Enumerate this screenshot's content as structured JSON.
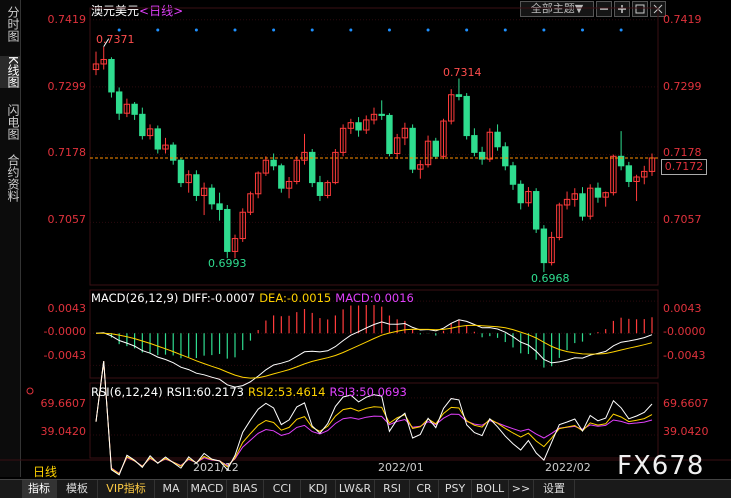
{
  "sidebar": {
    "tabs": [
      {
        "label": "分时图"
      },
      {
        "label": "K线图"
      },
      {
        "label": "闪电图"
      },
      {
        "label": "合约资料"
      }
    ]
  },
  "header": {
    "symbol": "澳元美元",
    "period": "<日线>",
    "theme_button": "全部主题",
    "theme_arrow": "▼"
  },
  "colors": {
    "up": "#ff3b3b",
    "down": "#2fdc8f",
    "macd_line": "#ffffff",
    "dea_line": "#ffd200",
    "macd_pos": "#ff3b3b",
    "macd_neg": "#2fdc8f",
    "rsi1": "#ffffff",
    "rsi2": "#ffd200",
    "rsi3": "#e040fb",
    "axis_text": "#e0323c",
    "current_price_line": "#ff8c00",
    "signal_dot": "#1e90ff"
  },
  "chart_data": [
    {
      "type": "candlestick",
      "ylim": [
        0.6945,
        0.744
      ],
      "y_ticks": [
        "0.7419",
        "0.7299",
        "0.7178",
        "0.7057"
      ],
      "current_price": "0.7172",
      "annotations": {
        "high1": "0.7371",
        "high2": "0.7314",
        "low1": "0.6993",
        "low2": "0.6968"
      },
      "x_labels": [
        "2021/12",
        "2022/01",
        "2022/02"
      ],
      "ohlc": [
        [
          0.733,
          0.7362,
          0.732,
          0.734
        ],
        [
          0.734,
          0.7371,
          0.733,
          0.7348
        ],
        [
          0.7348,
          0.7352,
          0.728,
          0.729
        ],
        [
          0.729,
          0.7298,
          0.724,
          0.7252
        ],
        [
          0.7252,
          0.7278,
          0.7245,
          0.7268
        ],
        [
          0.7268,
          0.7272,
          0.724,
          0.725
        ],
        [
          0.725,
          0.7262,
          0.7205,
          0.7212
        ],
        [
          0.7212,
          0.7232,
          0.7205,
          0.7224
        ],
        [
          0.7224,
          0.723,
          0.718,
          0.7188
        ],
        [
          0.7188,
          0.7208,
          0.718,
          0.7195
        ],
        [
          0.7195,
          0.72,
          0.716,
          0.7168
        ],
        [
          0.7168,
          0.7172,
          0.712,
          0.7128
        ],
        [
          0.7128,
          0.715,
          0.711,
          0.7142
        ],
        [
          0.7142,
          0.715,
          0.7095,
          0.7105
        ],
        [
          0.7105,
          0.7128,
          0.707,
          0.7118
        ],
        [
          0.7118,
          0.7125,
          0.708,
          0.709
        ],
        [
          0.709,
          0.711,
          0.706,
          0.708
        ],
        [
          0.708,
          0.7088,
          0.6993,
          0.7005
        ],
        [
          0.7005,
          0.7035,
          0.6993,
          0.7028
        ],
        [
          0.7028,
          0.7082,
          0.7022,
          0.7075
        ],
        [
          0.7075,
          0.7112,
          0.707,
          0.7108
        ],
        [
          0.7108,
          0.7148,
          0.71,
          0.7145
        ],
        [
          0.7145,
          0.7175,
          0.714,
          0.7168
        ],
        [
          0.7168,
          0.718,
          0.715,
          0.7158
        ],
        [
          0.7158,
          0.7162,
          0.711,
          0.7118
        ],
        [
          0.7118,
          0.7138,
          0.71,
          0.713
        ],
        [
          0.713,
          0.7175,
          0.7125,
          0.7168
        ],
        [
          0.7168,
          0.7215,
          0.716,
          0.7182
        ],
        [
          0.7182,
          0.7188,
          0.712,
          0.7128
        ],
        [
          0.7128,
          0.714,
          0.7095,
          0.7105
        ],
        [
          0.7105,
          0.7132,
          0.71,
          0.7128
        ],
        [
          0.7128,
          0.7188,
          0.7125,
          0.7182
        ],
        [
          0.7182,
          0.7232,
          0.7175,
          0.7225
        ],
        [
          0.7225,
          0.7242,
          0.7215,
          0.7235
        ],
        [
          0.7235,
          0.7245,
          0.721,
          0.7222
        ],
        [
          0.7222,
          0.7248,
          0.7215,
          0.724
        ],
        [
          0.724,
          0.7262,
          0.7232,
          0.725
        ],
        [
          0.725,
          0.7275,
          0.724,
          0.7248
        ],
        [
          0.7248,
          0.7252,
          0.7175,
          0.718
        ],
        [
          0.718,
          0.7215,
          0.717,
          0.7208
        ],
        [
          0.7208,
          0.7235,
          0.7195,
          0.7225
        ],
        [
          0.7225,
          0.7232,
          0.7145,
          0.7152
        ],
        [
          0.7152,
          0.7168,
          0.7135,
          0.716
        ],
        [
          0.716,
          0.7212,
          0.7155,
          0.7202
        ],
        [
          0.7202,
          0.7208,
          0.717,
          0.7175
        ],
        [
          0.7175,
          0.7242,
          0.717,
          0.7238
        ],
        [
          0.7238,
          0.7295,
          0.7232,
          0.7285
        ],
        [
          0.7285,
          0.7314,
          0.7275,
          0.7282
        ],
        [
          0.7282,
          0.7288,
          0.7205,
          0.7212
        ],
        [
          0.7212,
          0.7225,
          0.7175,
          0.7182
        ],
        [
          0.7182,
          0.7192,
          0.716,
          0.717
        ],
        [
          0.717,
          0.7225,
          0.7165,
          0.7218
        ],
        [
          0.7218,
          0.7232,
          0.7185,
          0.7192
        ],
        [
          0.7192,
          0.72,
          0.715,
          0.7158
        ],
        [
          0.7158,
          0.7165,
          0.7115,
          0.7125
        ],
        [
          0.7125,
          0.7132,
          0.708,
          0.7092
        ],
        [
          0.7092,
          0.712,
          0.7085,
          0.7112
        ],
        [
          0.7112,
          0.7118,
          0.7038,
          0.7045
        ],
        [
          0.7045,
          0.7052,
          0.6968,
          0.6985
        ],
        [
          0.6985,
          0.704,
          0.698,
          0.703
        ],
        [
          0.703,
          0.7092,
          0.7025,
          0.7088
        ],
        [
          0.7088,
          0.7112,
          0.708,
          0.7098
        ],
        [
          0.7098,
          0.7118,
          0.7085,
          0.7108
        ],
        [
          0.7108,
          0.712,
          0.706,
          0.7068
        ],
        [
          0.7068,
          0.7125,
          0.7062,
          0.7118
        ],
        [
          0.7118,
          0.7128,
          0.7092,
          0.7102
        ],
        [
          0.7102,
          0.7112,
          0.7085,
          0.711
        ],
        [
          0.711,
          0.7178,
          0.7105,
          0.7175
        ],
        [
          0.7175,
          0.722,
          0.715,
          0.7158
        ],
        [
          0.7158,
          0.7165,
          0.712,
          0.713
        ],
        [
          0.713,
          0.7142,
          0.7095,
          0.7138
        ],
        [
          0.7138,
          0.7158,
          0.7125,
          0.7148
        ],
        [
          0.7148,
          0.718,
          0.714,
          0.7172
        ]
      ]
    },
    {
      "type": "macd",
      "params": "MACD(26,12,9)",
      "diff_label": "DIFF:-0.0007",
      "dea_label": "DEA:-0.0015",
      "macd_label": "MACD:0.0016",
      "ylim": [
        -0.006,
        0.0058
      ],
      "y_ticks": [
        "0.0043",
        "-0.0000",
        "-0.0043"
      ]
    },
    {
      "type": "rsi",
      "params": "RSI(6,12,24)",
      "rsi1_label": "RSI1:60.2173",
      "rsi2_label": "RSI2:53.4614",
      "rsi3_label": "RSI3:50.0693",
      "y_ticks": [
        "69.6607",
        "39.0420"
      ],
      "ylim": [
        20,
        82
      ]
    }
  ],
  "footer": {
    "period_label": "日线",
    "watermark": "FX678",
    "tabs": [
      {
        "label": "指标"
      },
      {
        "label": "模板"
      },
      {
        "label": "VIP指标"
      },
      {
        "label": "MA"
      },
      {
        "label": "MACD"
      },
      {
        "label": "BIAS"
      },
      {
        "label": "CCI"
      },
      {
        "label": "KDJ"
      },
      {
        "label": "LW&R"
      },
      {
        "label": "RSI"
      },
      {
        "label": "CR"
      },
      {
        "label": "PSY"
      },
      {
        "label": "BOLL"
      },
      {
        "label": ">>"
      },
      {
        "label": "设置"
      }
    ]
  }
}
